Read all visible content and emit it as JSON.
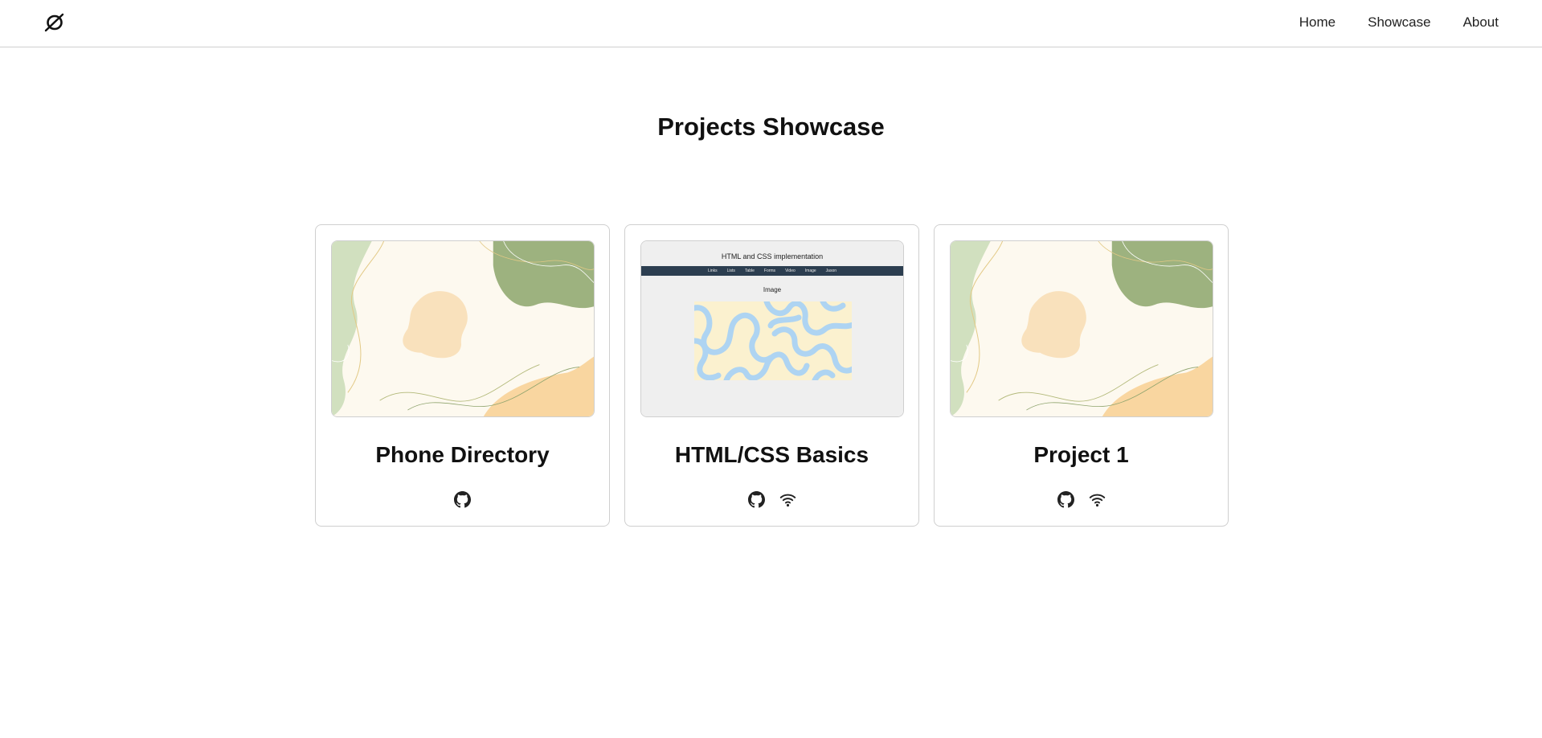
{
  "nav": {
    "links": [
      "Home",
      "Showcase",
      "About"
    ]
  },
  "page": {
    "title": "Projects Showcase"
  },
  "projects": [
    {
      "title": "Phone Directory",
      "thumbnail": "abstract-shapes",
      "icons": [
        "github-icon"
      ]
    },
    {
      "title": "HTML/CSS Basics",
      "thumbnail": "html-css-preview",
      "preview": {
        "heading": "HTML and CSS implementation",
        "nav_items": [
          "Links",
          "Lists",
          "Table",
          "Forms",
          "Video",
          "Image",
          "Jason"
        ],
        "subheading": "Image"
      },
      "icons": [
        "github-icon",
        "wifi-icon"
      ]
    },
    {
      "title": "Project 1",
      "thumbnail": "abstract-shapes",
      "icons": [
        "github-icon",
        "wifi-icon"
      ]
    }
  ],
  "colors": {
    "border": "#cfcfcf",
    "text": "#111111",
    "mini_nav": "#2c3e50"
  }
}
